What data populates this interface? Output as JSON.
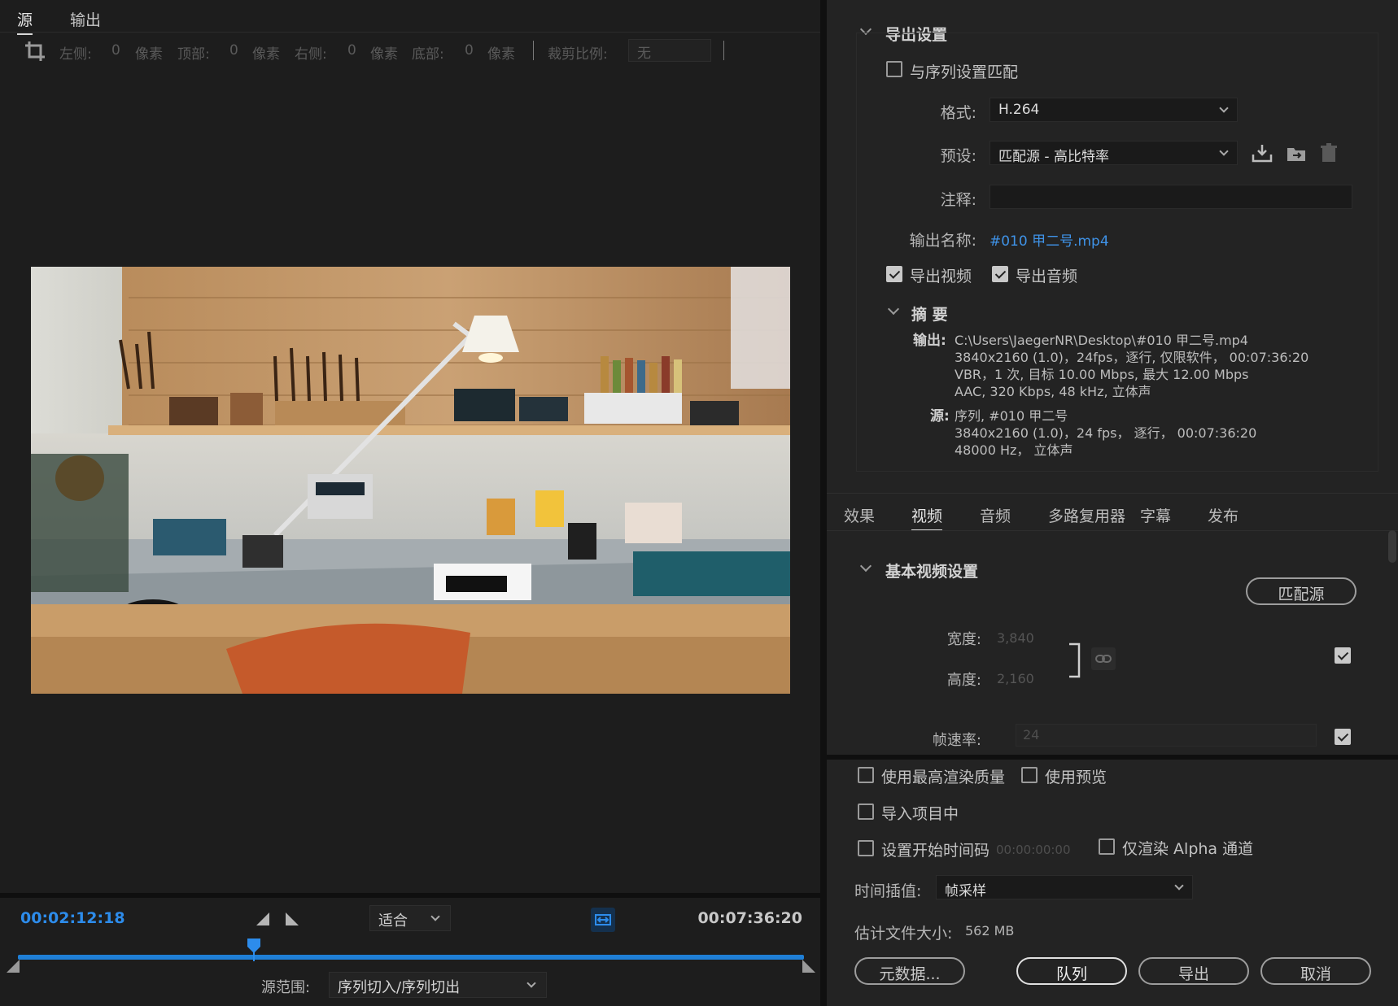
{
  "source_panel": {
    "tabs": [
      "源",
      "输出"
    ],
    "active_tab": 0,
    "crop": {
      "left_label": "左侧:",
      "left_value": "0",
      "left_unit": "像素",
      "top_label": "顶部:",
      "top_value": "0",
      "top_unit": "像素",
      "right_label": "右侧:",
      "right_value": "0",
      "right_unit": "像素",
      "bottom_label": "底部:",
      "bottom_value": "0",
      "bottom_unit": "像素",
      "ratio_label": "裁剪比例:",
      "ratio_value": "无"
    },
    "current_timecode": "00:02:12:18",
    "total_timecode": "00:07:36:20",
    "fit_value": "适合",
    "playhead_progress": 0.3,
    "source_range_label": "源范围:",
    "source_range_value": "序列切入/序列切出"
  },
  "export_settings": {
    "title": "导出设置",
    "match_sequence_label": "与序列设置匹配",
    "match_sequence_checked": false,
    "format_label": "格式:",
    "format_value": "H.264",
    "preset_label": "预设:",
    "preset_value": "匹配源 - 高比特率",
    "comment_label": "注释:",
    "comment_value": "",
    "output_name_label": "输出名称:",
    "output_name_value": "#010 甲二号.mp4",
    "export_video_label": "导出视频",
    "export_video_checked": true,
    "export_audio_label": "导出音频",
    "export_audio_checked": true,
    "summary": {
      "title": "摘 要",
      "output_key": "输出:",
      "output_lines": [
        "C:\\Users\\JaegerNR\\Desktop\\#010 甲二号.mp4",
        "3840x2160 (1.0)，24fps，逐行, 仅限软件，  00:07:36:20",
        "VBR，1 次, 目标 10.00 Mbps, 最大 12.00 Mbps",
        "AAC, 320 Kbps, 48   kHz, 立体声"
      ],
      "source_key": "源:",
      "source_lines": [
        "序列, #010 甲二号",
        "3840x2160 (1.0)，24 fps，  逐行，  00:07:36:20",
        "48000 Hz，  立体声"
      ]
    }
  },
  "settings_tabs": [
    "效果",
    "视频",
    "音频",
    "多路复用器",
    "字幕",
    "发布"
  ],
  "settings_active_tab": 1,
  "basic_video": {
    "title": "基本视频设置",
    "match_source_button": "匹配源",
    "width_label": "宽度:",
    "width_value": "3,840",
    "height_label": "高度:",
    "height_value": "2,160",
    "framerate_label": "帧速率:",
    "framerate_value": "24"
  },
  "bottom_options": {
    "max_quality_label": "使用最高渲染质量",
    "use_preview_label": "使用预览",
    "import_project_label": "导入项目中",
    "start_timecode_label": "设置开始时间码",
    "start_timecode_value": "00:00:00:00",
    "alpha_only_label": "仅渲染 Alpha 通道",
    "time_interp_label": "时间插值:",
    "time_interp_value": "帧采样",
    "est_size_label": "估计文件大小:",
    "est_size_value": "562 MB"
  },
  "buttons": {
    "metadata": "元数据...",
    "queue": "队列",
    "export": "导出",
    "cancel": "取消"
  },
  "colors": {
    "accent_blue": "#2d8ceb",
    "timeline_blue": "#1f7fd6",
    "panel_bg": "#232323",
    "left_bg": "#1d1d1d"
  }
}
